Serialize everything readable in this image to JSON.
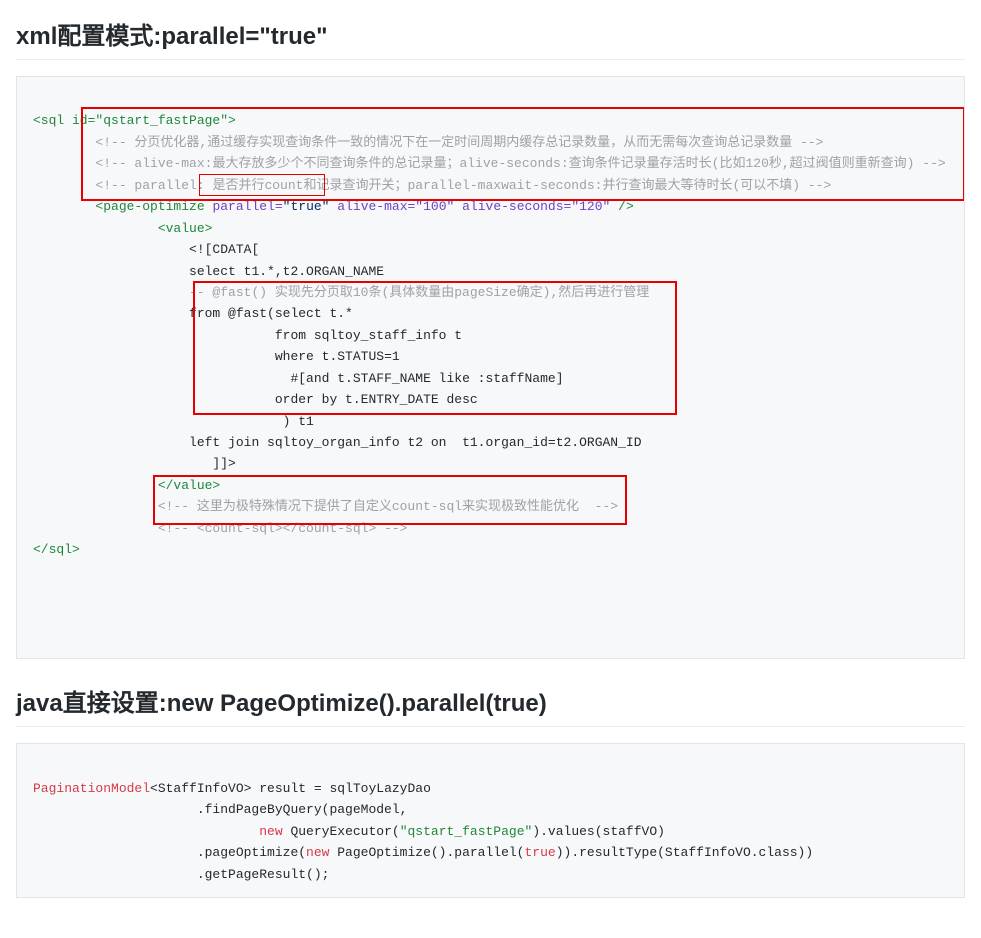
{
  "headings": {
    "xml": "xml配置模式:parallel=\"true\"",
    "java": "java直接设置:new PageOptimize().parallel(true)"
  },
  "xml": {
    "line01_open": "<sql id=\"qstart_fastPage\">",
    "line02_c": "<!-- 分页优化器,通过缓存实现查询条件一致的情况下在一定时间周期内缓存总记录数量，从而无需每次查询总记录数量 -->",
    "line03_c": "<!-- alive-max:最大存放多少个不同查询条件的总记录量；alive-seconds:查询条件记录量存活时长(比如120秒,超过阀值则重新查询) -->",
    "line04_c": "<!-- parallel: 是否并行count和记录查询开关；parallel-maxwait-seconds:并行查询最大等待时长(可以不填) -->",
    "line05_tag_open": "<page-optimize ",
    "line05_attr_parallel_name": "parallel=",
    "line05_attr_parallel_val": "\"true\"",
    "line05_attr_alivemax": " alive-max=\"100\"",
    "line05_attr_alivesec": " alive-seconds=\"120\"",
    "line05_close": " />",
    "line06": "<value>",
    "line07": "<![CDATA[",
    "line08": "select t1.*,t2.ORGAN_NAME",
    "line09": "-- @fast() 实现先分页取10条(具体数量由pageSize确定),然后再进行管理",
    "line10": "from @fast(select t.*",
    "line11": "           from sqltoy_staff_info t",
    "line12": "           where t.STATUS=1",
    "line13": "             #[and t.STAFF_NAME like :staffName]",
    "line14": "           order by t.ENTRY_DATE desc",
    "line15": "            ) t1",
    "line16": "left join sqltoy_organ_info t2 on  t1.organ_id=t2.ORGAN_ID",
    "line17": "   ]]>",
    "line18": "</value>",
    "line19_c": "<!-- 这里为极特殊情况下提供了自定义count-sql来实现极致性能优化  -->",
    "line20_c": "<!-- <count-sql></count-sql> -->",
    "line21": "</sql>"
  },
  "java": {
    "line01a": "PaginationModel",
    "line01b": "<StaffInfoVO>",
    "line01c": " result = sqlToyLazyDao",
    "line02": "                     .findPageByQuery(pageModel,",
    "line03a": "                             ",
    "line03_new": "new",
    "line03b": " QueryExecutor(",
    "line03_str": "\"qstart_fastPage\"",
    "line03c": ").values(staffVO)",
    "line04a": "                     .pageOptimize(",
    "line04_new": "new",
    "line04b": " PageOptimize().parallel(",
    "line04_true": "true",
    "line04c": ")).resultType(StaffInfoVO.class))",
    "line05": "                     .getPageResult();"
  }
}
